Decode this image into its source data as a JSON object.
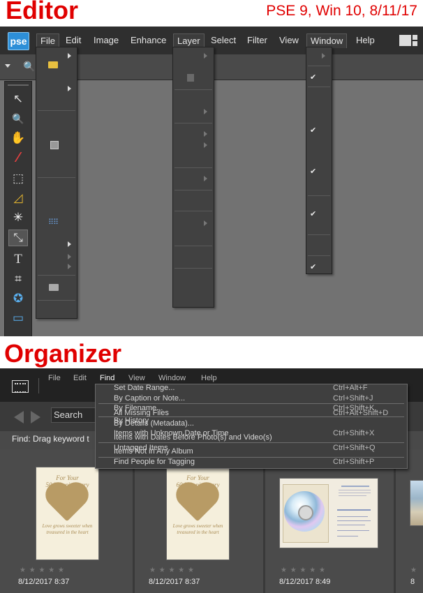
{
  "labels": {
    "editor_title": "Editor",
    "version_note": "PSE 9, Win 10, 8/11/17",
    "organizer_title": "Organizer"
  },
  "editor": {
    "logo": "pse",
    "menus": [
      "File",
      "Edit",
      "Image",
      "Enhance",
      "Layer",
      "Select",
      "Filter",
      "View",
      "Window",
      "Help"
    ],
    "tools": [
      "move-icon",
      "zoom-icon",
      "hand-icon",
      "eyedropper-icon",
      "marquee-icon",
      "lasso-icon",
      "magic-wand-icon",
      "quick-selection-icon",
      "type-icon",
      "crop-icon",
      "shape-icon",
      "recompose-icon"
    ],
    "tool_glyphs": [
      "↖",
      "🔍",
      "✋",
      "⁄",
      "⬚",
      "◿",
      "✳",
      "⤡",
      "T",
      "⌗",
      "✪",
      "▭"
    ]
  },
  "organizer": {
    "menus": [
      "File",
      "Edit",
      "Find",
      "View",
      "Window",
      "Help"
    ],
    "search_placeholder": "Search",
    "find_bar": "Find: Drag keyword t",
    "find_menu": [
      {
        "label": "Set Date Range...",
        "shortcut": "Ctrl+Alt+F"
      },
      {
        "label": "By Caption or Note...",
        "shortcut": "Ctrl+Shift+J"
      },
      {
        "label": "By Filename...",
        "shortcut": "Ctrl+Shift+K"
      },
      {
        "label": "All Missing Files",
        "shortcut": "Ctrl+Alt+Shift+D"
      },
      {
        "label": "By History",
        "shortcut": ""
      },
      {
        "label": "By Details (Metadata)...",
        "shortcut": ""
      },
      {
        "label": "Items with Unknown Date or Time",
        "shortcut": "Ctrl+Shift+X"
      },
      {
        "label": "Items with Dates Before Photo(s) and Video(s)",
        "shortcut": ""
      },
      {
        "label": "Untagged Items",
        "shortcut": "Ctrl+Shift+Q"
      },
      {
        "label": "Items Not in Any Album",
        "shortcut": ""
      },
      {
        "label": "Find People for Tagging",
        "shortcut": "Ctrl+Shift+P"
      }
    ],
    "thumbnails": [
      {
        "kind": "card",
        "line1": "For Your",
        "line2": "50th Anniversary",
        "verse": "Love grows sweeter when treasured in the heart",
        "date": "8/12/2017 8:37"
      },
      {
        "kind": "card",
        "line1": "For Your",
        "line2": "60th Anniversary",
        "verse": "Love grows sweeter when treasured in the heart",
        "date": "8/12/2017 8:37"
      },
      {
        "kind": "cd",
        "date": "8/12/2017 8:49"
      }
    ],
    "stars": "★ ★ ★ ★ ★"
  },
  "colors": {
    "title_red": "#e00000",
    "editor_canvas": "#727272",
    "menu_dark": "#2f2f2f"
  }
}
